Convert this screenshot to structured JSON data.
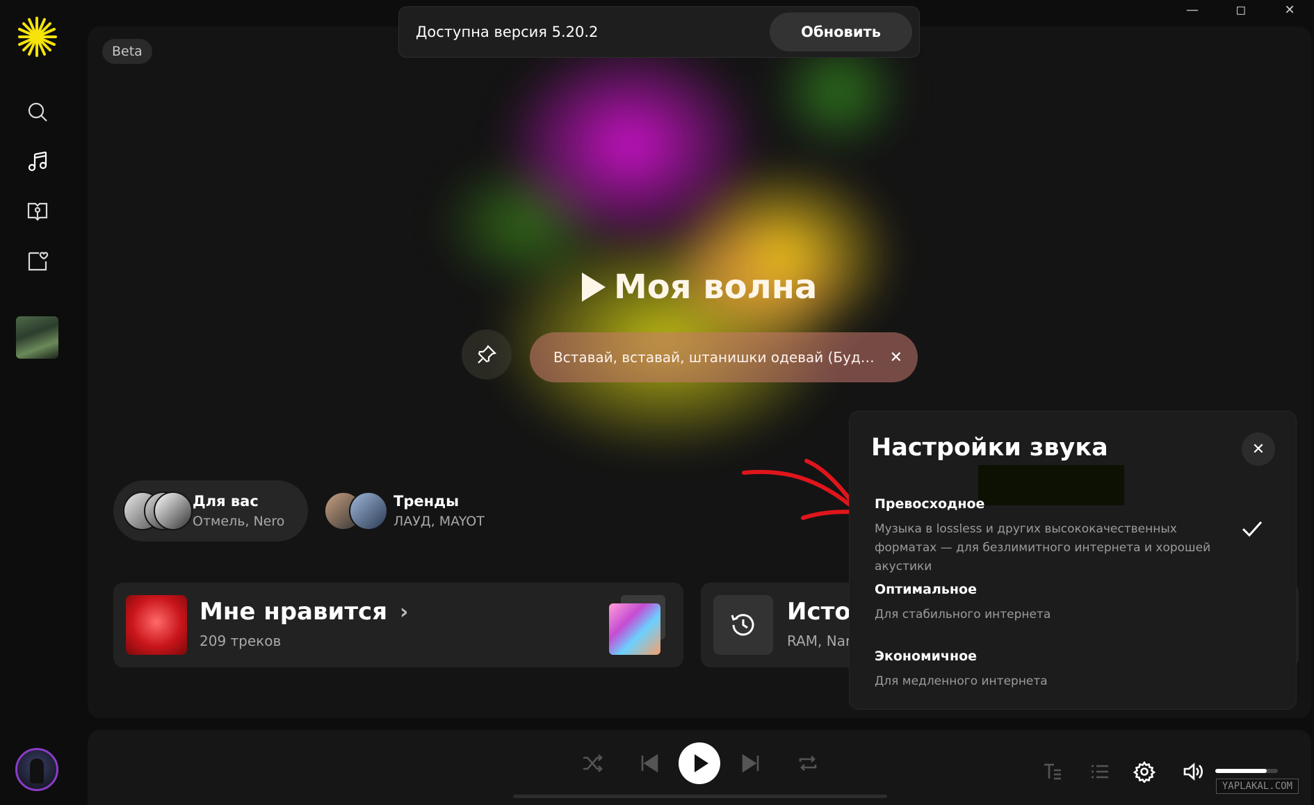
{
  "update_banner": {
    "message": "Доступна версия 5.20.2",
    "button": "Обновить"
  },
  "main": {
    "beta_badge": "Beta",
    "wave_title": "Моя волна",
    "wave_chip": "Вставай, вставай, штанишки одевай (Будильник)",
    "pills": [
      {
        "title": "Для вас",
        "subtitle": "Отмель, Nero"
      },
      {
        "title": "Тренды",
        "subtitle": "ЛАУД, MAYOT"
      }
    ],
    "cards": [
      {
        "title": "Мне нравится",
        "subtitle": "209 треков"
      },
      {
        "title": "Истор",
        "subtitle": "RAM, Nar"
      }
    ]
  },
  "sound_settings": {
    "title": "Настройки звука",
    "options": [
      {
        "name": "Превосходное",
        "description": "Музыка в lossless и других высококачественных форматах — для безлимитного интернета и хорошей акустики",
        "selected": true
      },
      {
        "name": "Оптимальное",
        "description": "Для стабильного интернета",
        "selected": false
      },
      {
        "name": "Экономичное",
        "description": "Для медленного интернета",
        "selected": false
      }
    ]
  },
  "player": {
    "volume": 0.82,
    "progress": 0
  },
  "watermark": "YAPLAKAL.COM",
  "colors": {
    "accent_yellow": "#f5d90a",
    "annotation_red": "#e0151c",
    "selected_pill": "#262626"
  },
  "icons": {
    "sidebar": [
      "search-icon",
      "music-note-icon",
      "podcast-book-icon",
      "heart-collection-icon"
    ],
    "player": [
      "shuffle-icon",
      "previous-icon",
      "play-icon",
      "next-icon",
      "repeat-icon",
      "lyrics-icon",
      "queue-icon",
      "gear-icon",
      "volume-icon"
    ]
  }
}
